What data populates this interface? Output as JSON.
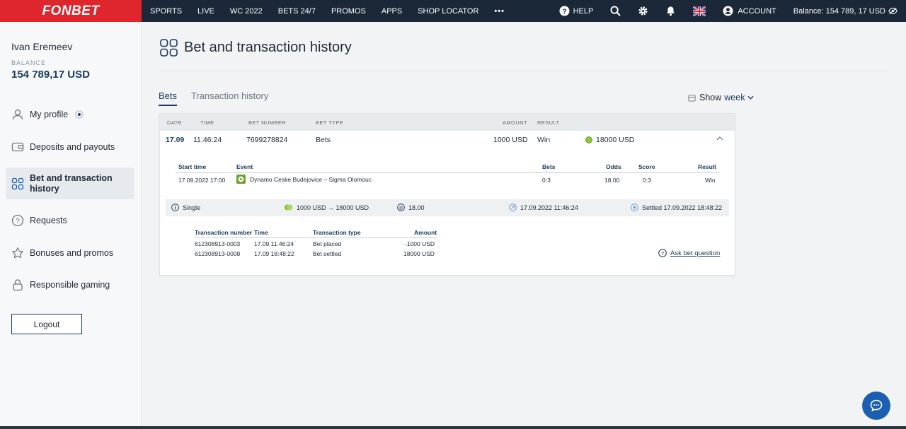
{
  "topbar": {
    "logo": "FONBET",
    "nav": [
      "SPORTS",
      "LIVE",
      "WC 2022",
      "BETS 24/7",
      "PROMOS",
      "APPS",
      "SHOP LOCATOR"
    ],
    "more": "•••",
    "help": "HELP",
    "account": "ACCOUNT",
    "balance": "Balance: 154 789, 17 USD"
  },
  "sidebar": {
    "user_name": "Ivan Eremeev",
    "balance_label": "BALANCE",
    "balance_value": "154 789,17 USD",
    "menu": [
      {
        "label": "My profile",
        "icon": "user-icon"
      },
      {
        "label": "Deposits and payouts",
        "icon": "wallet-icon"
      },
      {
        "label": "Bet and transaction history",
        "icon": "grid-icon"
      },
      {
        "label": "Requests",
        "icon": "question-icon"
      },
      {
        "label": "Bonuses and promos",
        "icon": "star-icon"
      },
      {
        "label": "Responsible gaming",
        "icon": "lock-icon"
      }
    ],
    "logout": "Logout"
  },
  "main": {
    "title": "Bet and transaction history",
    "tabs": [
      "Bets",
      "Transaction history"
    ],
    "show_label": "Show",
    "show_value": "week",
    "table_headers": {
      "date": "DATE",
      "time": "TIME",
      "bet_number": "BET NUMBER",
      "bet_type": "BET TYPE",
      "amount": "AMOUNT",
      "result": "RESULT"
    },
    "bet": {
      "date": "17.09",
      "time": "11:46:24",
      "bet_number": "7699278824",
      "bet_type": "Bets",
      "amount": "1000 USD",
      "result": "Win",
      "payout": "18000 USD"
    },
    "detail_headers": {
      "start_time": "Start time",
      "event": "Event",
      "bets": "Bets",
      "odds": "Odds",
      "score": "Score",
      "result": "Result"
    },
    "detail_row": {
      "start_time": "17.09.2022 17:00",
      "event": "Dynamo Ceske Budejovice – Sigma Olomouc",
      "bets": "0:3",
      "odds": "18.00",
      "score": "0:3",
      "result": "Win"
    },
    "summary": {
      "type": "Single",
      "stake": "1000 USD → 18000 USD",
      "odds": "18.00",
      "placed": "17.09.2022 11:46:24",
      "settled": "Settled 17.09.2022 18:48:22"
    },
    "transactions": {
      "headers": {
        "number": "Transaction number",
        "time": "Time",
        "type": "Transaction type",
        "amount": "Amount"
      },
      "rows": [
        {
          "number": "612308913-0003",
          "time": "17.09 11:46:24",
          "type": "Bet placed",
          "amount": "-1000 USD"
        },
        {
          "number": "612308913-0008",
          "time": "17.09 18:48:22",
          "type": "Bet settled",
          "amount": "18000 USD"
        }
      ]
    },
    "ask": "Ask bet question"
  },
  "colors": {
    "brand_red": "#e0262d",
    "nav_dark": "#1b2838",
    "accent": "#1b3a5c",
    "win_green": "#8ec641"
  }
}
